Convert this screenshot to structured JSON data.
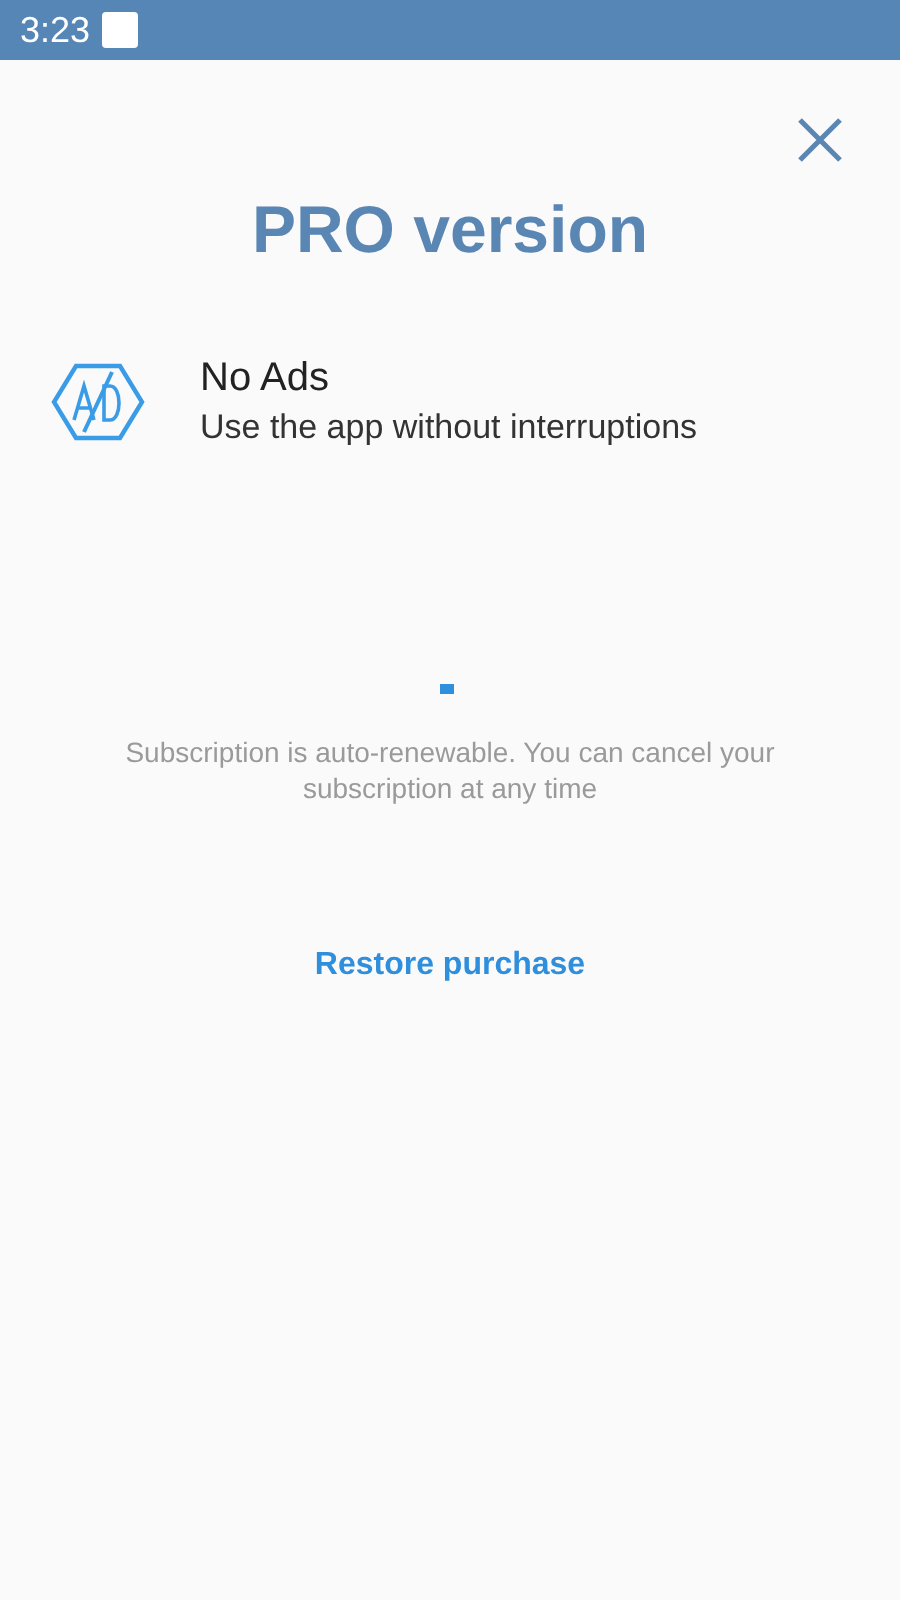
{
  "status_bar": {
    "time": "3:23"
  },
  "title": "PRO version",
  "features": [
    {
      "title": "No Ads",
      "description": "Use the app without interruptions"
    }
  ],
  "note": "Subscription is auto-renewable. You can cancel your subscription at any time",
  "restore_button": {
    "label": "Restore purchase"
  }
}
